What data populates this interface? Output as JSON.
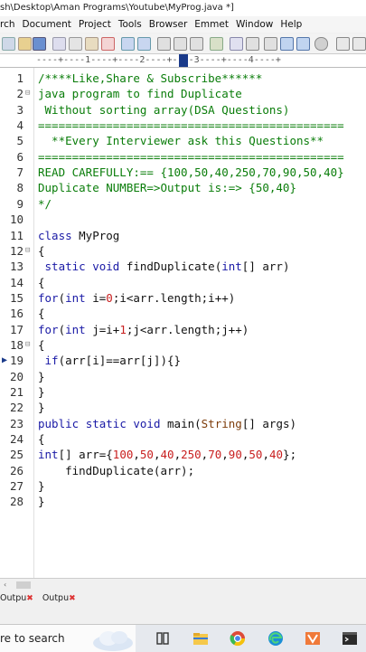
{
  "window": {
    "title": "sh\\Desktop\\Aman Programs\\Youtube\\MyProg.java *]"
  },
  "menu": [
    "rch",
    "Document",
    "Project",
    "Tools",
    "Browser",
    "Emmet",
    "Window",
    "Help"
  ],
  "ruler": {
    "text": "----+----1----+----2----+----3----+----4----+",
    "numbers": [
      "1",
      "2",
      "3",
      "4"
    ]
  },
  "code_lines": [
    {
      "n": "1",
      "fold": "",
      "tokens": [
        {
          "t": "/****Like,Share & Subscribe******",
          "c": "c-green"
        }
      ]
    },
    {
      "n": "2",
      "fold": "⊟",
      "tokens": [
        {
          "t": "java program to find Duplicate",
          "c": "c-green"
        }
      ]
    },
    {
      "n": "3",
      "fold": "",
      "tokens": [
        {
          "t": " Without sorting array(DSA Questions)",
          "c": "c-green"
        }
      ]
    },
    {
      "n": "4",
      "fold": "",
      "tokens": [
        {
          "t": "=============================================",
          "c": "c-green"
        }
      ]
    },
    {
      "n": "5",
      "fold": "",
      "tokens": [
        {
          "t": "  **Every Interviewer ask this Questions**",
          "c": "c-green"
        }
      ]
    },
    {
      "n": "6",
      "fold": "",
      "tokens": [
        {
          "t": "=============================================",
          "c": "c-green"
        }
      ]
    },
    {
      "n": "7",
      "fold": "",
      "tokens": [
        {
          "t": "READ CAREFULLY:== {100,50,40,250,70,90,50,40}",
          "c": "c-green"
        }
      ]
    },
    {
      "n": "8",
      "fold": "",
      "tokens": [
        {
          "t": "Duplicate NUMBER=>Output is:=> {50,40}",
          "c": "c-green"
        }
      ]
    },
    {
      "n": "9",
      "fold": "",
      "tokens": [
        {
          "t": "*/",
          "c": "c-green"
        }
      ]
    },
    {
      "n": "10",
      "fold": "",
      "tokens": []
    },
    {
      "n": "11",
      "fold": "",
      "tokens": [
        {
          "t": "class ",
          "c": "c-blue"
        },
        {
          "t": "MyProg",
          "c": "c-black"
        }
      ]
    },
    {
      "n": "12",
      "fold": "⊟",
      "tokens": [
        {
          "t": "{",
          "c": "c-black"
        }
      ]
    },
    {
      "n": "13",
      "fold": "",
      "tokens": [
        {
          "t": " static ",
          "c": "c-blue"
        },
        {
          "t": "void ",
          "c": "c-blue"
        },
        {
          "t": "findDuplicate(",
          "c": "c-black"
        },
        {
          "t": "int",
          "c": "c-blue"
        },
        {
          "t": "[] arr)",
          "c": "c-black"
        }
      ]
    },
    {
      "n": "14",
      "fold": "",
      "tokens": [
        {
          "t": "{",
          "c": "c-black"
        }
      ]
    },
    {
      "n": "15",
      "fold": "",
      "tokens": [
        {
          "t": "for",
          "c": "c-blue"
        },
        {
          "t": "(",
          "c": "c-black"
        },
        {
          "t": "int ",
          "c": "c-blue"
        },
        {
          "t": "i=",
          "c": "c-black"
        },
        {
          "t": "0",
          "c": "c-red"
        },
        {
          "t": ";i<arr.length;i++)",
          "c": "c-black"
        }
      ]
    },
    {
      "n": "16",
      "fold": "",
      "tokens": [
        {
          "t": "{",
          "c": "c-black"
        }
      ]
    },
    {
      "n": "17",
      "fold": "",
      "tokens": [
        {
          "t": "for",
          "c": "c-blue"
        },
        {
          "t": "(",
          "c": "c-black"
        },
        {
          "t": "int ",
          "c": "c-blue"
        },
        {
          "t": "j=i+",
          "c": "c-black"
        },
        {
          "t": "1",
          "c": "c-red"
        },
        {
          "t": ";j<arr.length;j++)",
          "c": "c-black"
        }
      ]
    },
    {
      "n": "18",
      "fold": "⊟",
      "tokens": [
        {
          "t": "{",
          "c": "c-black"
        }
      ]
    },
    {
      "n": "19",
      "fold": "",
      "tokens": [
        {
          "t": " if",
          "c": "c-blue"
        },
        {
          "t": "(arr[i]==arr[j]){}",
          "c": "c-black"
        }
      ]
    },
    {
      "n": "20",
      "fold": "",
      "tokens": [
        {
          "t": "}",
          "c": "c-black"
        }
      ]
    },
    {
      "n": "21",
      "fold": "",
      "tokens": [
        {
          "t": "}",
          "c": "c-black"
        }
      ]
    },
    {
      "n": "22",
      "fold": "",
      "tokens": [
        {
          "t": "}",
          "c": "c-black"
        }
      ]
    },
    {
      "n": "23",
      "fold": "",
      "tokens": [
        {
          "t": "public ",
          "c": "c-blue"
        },
        {
          "t": "static ",
          "c": "c-blue"
        },
        {
          "t": "void ",
          "c": "c-blue"
        },
        {
          "t": "main(",
          "c": "c-black"
        },
        {
          "t": "String",
          "c": "c-brown"
        },
        {
          "t": "[] args)",
          "c": "c-black"
        }
      ]
    },
    {
      "n": "24",
      "fold": "",
      "tokens": [
        {
          "t": "{",
          "c": "c-black"
        }
      ]
    },
    {
      "n": "25",
      "fold": "",
      "tokens": [
        {
          "t": "int",
          "c": "c-blue"
        },
        {
          "t": "[] arr={",
          "c": "c-black"
        },
        {
          "t": "100",
          "c": "c-red"
        },
        {
          "t": ",",
          "c": "c-black"
        },
        {
          "t": "50",
          "c": "c-red"
        },
        {
          "t": ",",
          "c": "c-black"
        },
        {
          "t": "40",
          "c": "c-red"
        },
        {
          "t": ",",
          "c": "c-black"
        },
        {
          "t": "250",
          "c": "c-red"
        },
        {
          "t": ",",
          "c": "c-black"
        },
        {
          "t": "70",
          "c": "c-red"
        },
        {
          "t": ",",
          "c": "c-black"
        },
        {
          "t": "90",
          "c": "c-red"
        },
        {
          "t": ",",
          "c": "c-black"
        },
        {
          "t": "50",
          "c": "c-red"
        },
        {
          "t": ",",
          "c": "c-black"
        },
        {
          "t": "40",
          "c": "c-red"
        },
        {
          "t": "};",
          "c": "c-black"
        }
      ]
    },
    {
      "n": "26",
      "fold": "",
      "tokens": [
        {
          "t": "    findDuplicate(arr);",
          "c": "c-black"
        }
      ]
    },
    {
      "n": "27",
      "fold": "",
      "tokens": [
        {
          "t": "}",
          "c": "c-black"
        }
      ]
    },
    {
      "n": "28",
      "fold": "",
      "tokens": [
        {
          "t": "}",
          "c": "c-black"
        }
      ]
    }
  ],
  "output_tabs": [
    "Outpu",
    "Outpu"
  ],
  "taskbar": {
    "search_text": "re to search",
    "icons": [
      "task-view-icon",
      "file-explorer-icon",
      "chrome-icon",
      "edge-icon",
      "app-icon",
      "terminal-icon"
    ]
  }
}
